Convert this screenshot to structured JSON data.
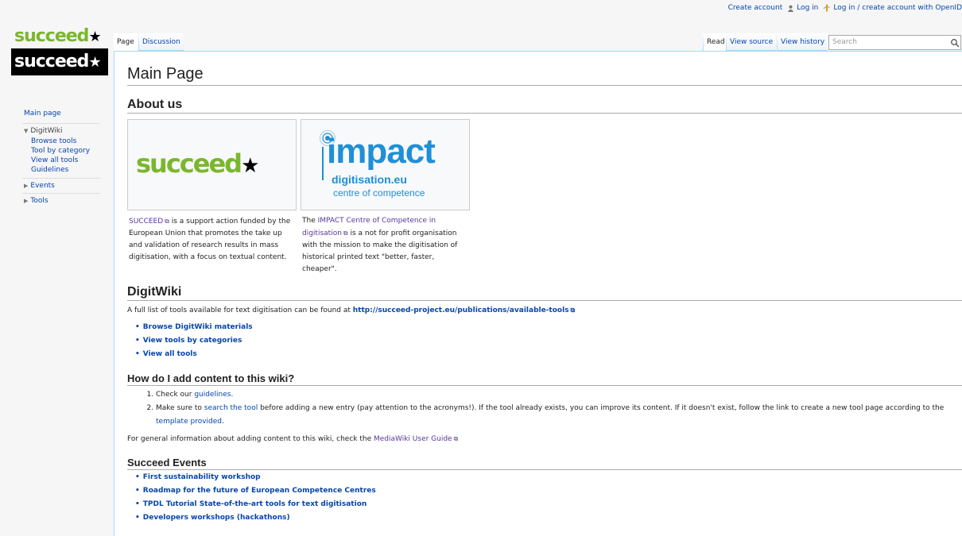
{
  "personal": {
    "create_account": "Create account",
    "log_in": "Log in",
    "openid": "Log in / create account with OpenID"
  },
  "logo": {
    "text": "succeed"
  },
  "sidebar": {
    "main_page": "Main page",
    "portals": [
      {
        "title": "DigitWiki",
        "items": [
          "Browse tools",
          "Tool by category",
          "View all tools",
          "Guidelines"
        ]
      },
      {
        "title": "Events"
      },
      {
        "title": "Tools"
      }
    ]
  },
  "tabs": {
    "page": "Page",
    "discussion": "Discussion",
    "read": "Read",
    "view_source": "View source",
    "view_history": "View history",
    "search_placeholder": "Search"
  },
  "content": {
    "title": "Main Page",
    "about": {
      "heading": "About us",
      "succeed_logo": "succeed",
      "impact_logo": {
        "big": "impact",
        "domain": "digitisation.eu",
        "tagline": "centre of competence"
      },
      "succeed_link": "SUCCEED",
      "succeed_text": " is a support action funded by the European Union that promotes the take up and validation of research results in mass digitisation, with a focus on textual content.",
      "impact_pre": "The ",
      "impact_link": "IMPACT Centre of Competence in digitisation",
      "impact_text": " is a not for profit organisation with the mission to make the digitisation of historical printed text \"better, faster, cheaper\"."
    },
    "digitwiki": {
      "heading": "DigitWiki",
      "intro": "A full list of tools available for text digitisation can be found at ",
      "intro_link": "http://succeed-project.eu/publications/available-tools",
      "links": [
        "Browse DigitWiki materials",
        "View tools by categories",
        "View all tools"
      ]
    },
    "howto": {
      "heading": "How do I add content to this wiki?",
      "step1_pre": "Check our ",
      "step1_link": "guidelines",
      "step1_post": ".",
      "step2_pre": "Make sure to ",
      "step2_link": "search the tool",
      "step2_mid": " before adding a new entry (pay attention to the acronyms!). If the tool already exists, you can improve its content. If it doesn't exist, follow the link to create a new tool page according to the ",
      "step2_link2": "template provided",
      "step2_post": ".",
      "general_pre": "For general information about adding content to this wiki, check the ",
      "general_link": "MediaWiki User Guide"
    },
    "events": {
      "heading": "Succeed Events",
      "links": [
        "First sustainability workshop",
        "Roadmap for the future of European Competence Centres",
        "TPDL Tutorial State-of-the-art tools for text digitisation",
        "Developers workshops (hackathons)"
      ]
    }
  }
}
